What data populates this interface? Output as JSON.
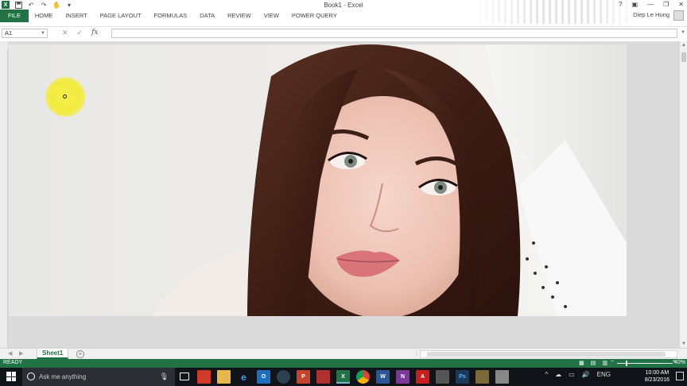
{
  "window": {
    "title": "Book1 - Excel",
    "controls": {
      "help": "?",
      "ribbon_display": "▣",
      "minimize": "—",
      "maximize": "❐",
      "close": "✕"
    }
  },
  "quick_access": {
    "logo": "X",
    "save": "💾",
    "undo": "↶",
    "redo": "↷",
    "touch": "✋",
    "customize": "▾"
  },
  "ribbon": {
    "tabs": [
      "FILE",
      "HOME",
      "INSERT",
      "PAGE LAYOUT",
      "FORMULAS",
      "DATA",
      "REVIEW",
      "VIEW",
      "POWER QUERY"
    ],
    "user": "Diep Le Hung"
  },
  "formula_bar": {
    "name_box": "A1",
    "cancel": "✕",
    "enter": "✓",
    "fx": "fx",
    "formula": ""
  },
  "sheet": {
    "embedded_picture": "portrait-photo",
    "cursor_highlight_color": "#f2ec3f"
  },
  "sheet_tabs": {
    "tabs": [
      "Sheet1"
    ],
    "active": "Sheet1",
    "add": "+"
  },
  "status_bar": {
    "ready": "READY",
    "zoom": "40%",
    "zoom_level": 40
  },
  "taskbar": {
    "search_placeholder": "Ask me anything",
    "apps": [
      "task-view",
      "store",
      "file-explorer",
      "edge",
      "outlook",
      "steam",
      "powerpoint",
      "tv-app",
      "excel",
      "chrome",
      "word",
      "onenote",
      "acrobat",
      "snipping",
      "photoshop",
      "photos",
      "media"
    ],
    "app_labels": [
      "",
      "",
      "",
      "e",
      "O",
      "",
      "P",
      "",
      "X",
      "",
      "W",
      "N",
      "A",
      "",
      "Ps",
      "",
      ""
    ],
    "tray": {
      "chevron": "^",
      "language": "ENG"
    },
    "time": "10:00 AM",
    "date": "8/23/2016"
  },
  "colors": {
    "excel_green": "#217346",
    "taskbar": "#101418"
  }
}
